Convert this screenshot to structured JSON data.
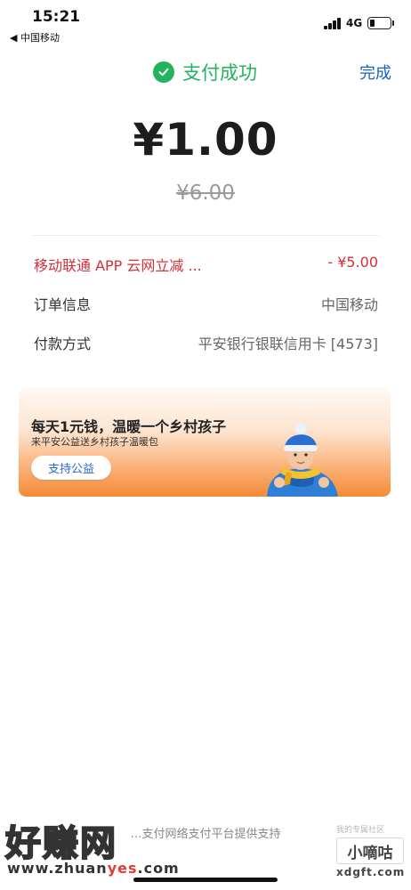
{
  "status_bar": {
    "time": "15:21",
    "back_carrier": "◀ 中国移动",
    "network": "4G"
  },
  "header": {
    "title": "支付成功",
    "done_label": "完成",
    "accent_color": "#22b35e",
    "done_color": "#1a62c4"
  },
  "payment": {
    "amount": "¥1.00",
    "original_amount": "¥6.00"
  },
  "details": {
    "discount_label": "移动联通 APP 云网立减 ...",
    "discount_value": "- ¥5.00",
    "order_label": "订单信息",
    "order_value": "中国移动",
    "payment_method_label": "付款方式",
    "payment_method_value": "平安银行银联信用卡 [4573]"
  },
  "banner": {
    "title": "每天1元钱，温暖一个乡村孩子",
    "subtitle": "来平安公益送乡村孩子温暖包",
    "button_label": "支持公益"
  },
  "footer": {
    "text": "…支付网络支付平台提供支持"
  },
  "watermarks": {
    "left_logo": "好赚网",
    "left_url_pre": "www.zhuan",
    "left_url_yes": "yes",
    "left_url_post": ".com",
    "right_top": "我的专属社区",
    "right_box": "小嘀咕",
    "right_url": "xdgft.com"
  }
}
